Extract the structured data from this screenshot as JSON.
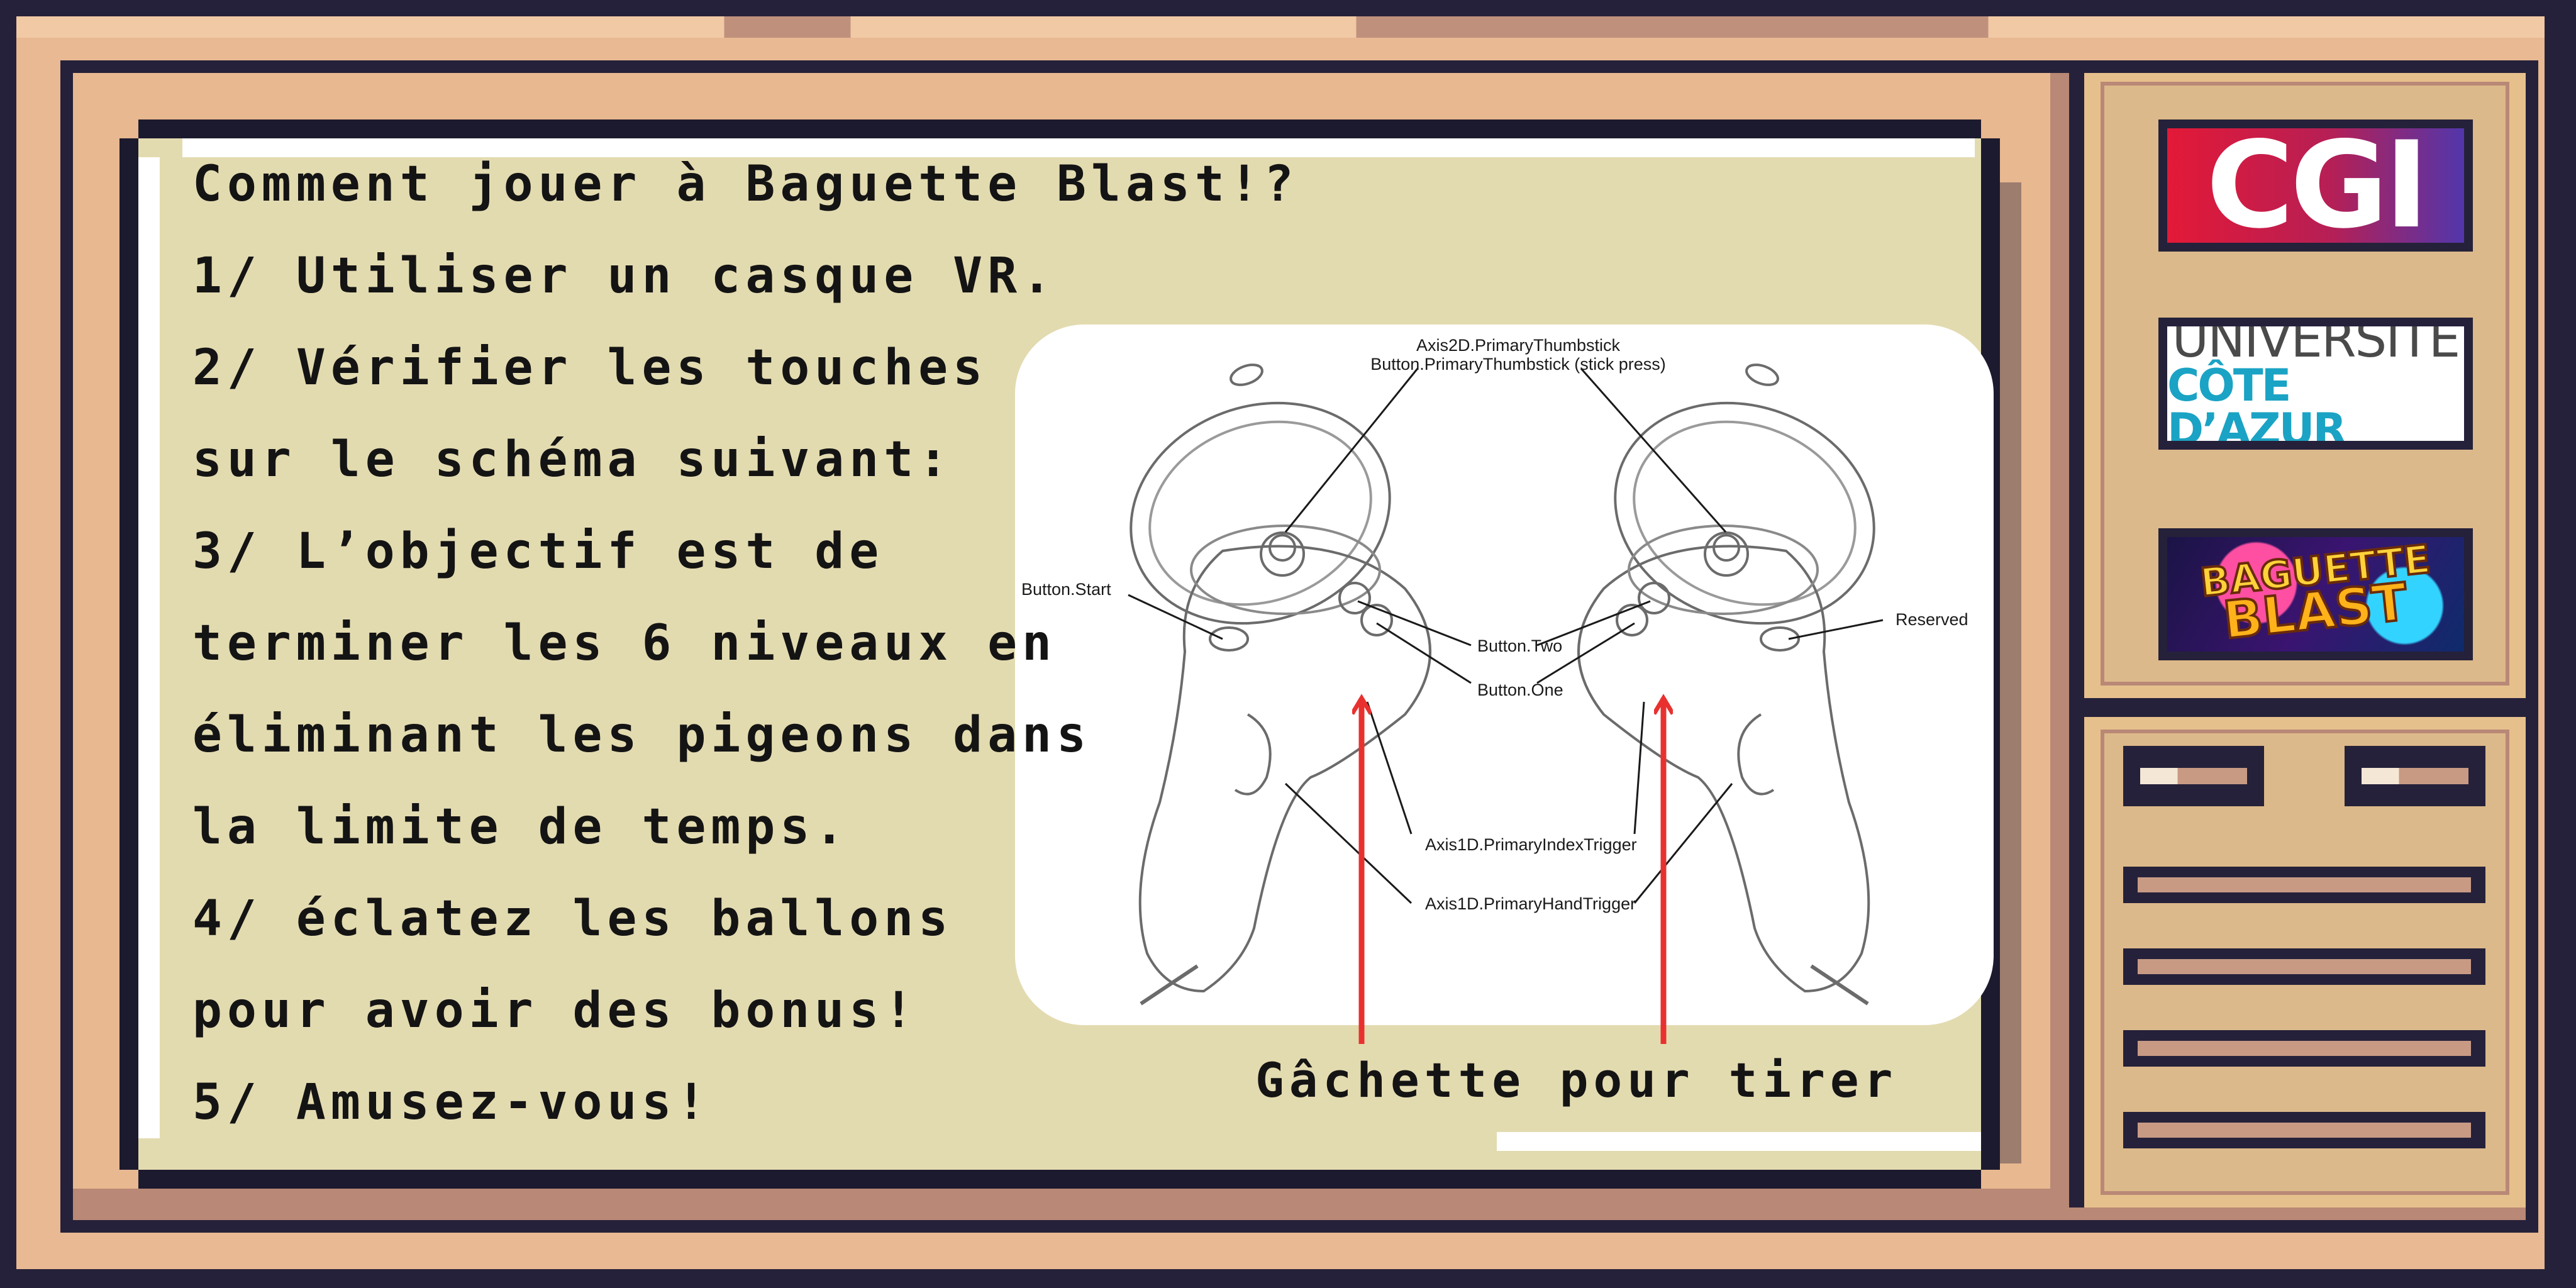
{
  "instructions": {
    "title": "Comment jouer à Baguette Blast!?",
    "lines": [
      "1/ Utiliser un casque VR.",
      "2/ Vérifier les touches",
      "sur le schéma suivant:",
      "3/ L’objectif est de",
      "terminer les 6 niveaux en",
      "éliminant les pigeons dans",
      "la limite de temps.",
      "4/ éclatez les ballons",
      "pour avoir des bonus!",
      "5/ Amusez-vous!"
    ]
  },
  "diagram": {
    "labels": {
      "thumbstick_axis": "Axis2D.PrimaryThumbstick",
      "thumbstick_press": "Button.PrimaryThumbstick (stick press)",
      "start": "Button.Start",
      "reserved": "Reserved",
      "button_two": "Button.Two",
      "button_one": "Button.One",
      "index_trigger": "Axis1D.PrimaryIndexTrigger",
      "hand_trigger": "Axis1D.PrimaryHandTrigger"
    },
    "caption": "Gâchette pour tirer",
    "arrow_color": "#e8312f"
  },
  "sidebar": {
    "logos": {
      "cgi": "CGI",
      "uca_line1": "UNIVERSITÉ",
      "uca_line2": "CÔTE D’AZUR",
      "game_line1": "BAGUETTE",
      "game_line2": "BLAST"
    }
  },
  "colors": {
    "frame_dark": "#25213a",
    "frame_peach": "#e9b993",
    "screen_bg": "#e3dbb0",
    "side_panel": "#e6c08c"
  }
}
